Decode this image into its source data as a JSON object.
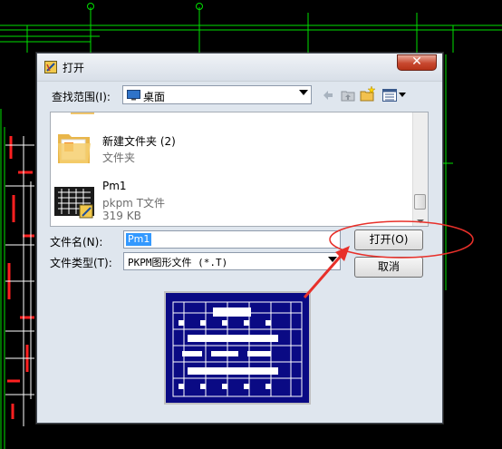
{
  "dialog": {
    "title": "打开",
    "close_glyph": "✕",
    "look_in_label": "查找范围(I):",
    "look_in_value": "桌面",
    "files": [
      {
        "name": "新建文件夹 (2)",
        "type": "文件夹",
        "size": ""
      },
      {
        "name": "Pm1",
        "type": "pkpm T文件",
        "size": "319 KB"
      }
    ],
    "file_name_label": "文件名(N):",
    "file_name_value": "Pm1",
    "file_type_label": "文件类型(T):",
    "file_type_value": "PKPM图形文件 (*.T)",
    "open_button": "打开(O)",
    "cancel_button": "取消"
  },
  "icons": {
    "title": "pkpm-app-icon",
    "back": "back-arrow-icon",
    "up": "up-folder-icon",
    "new_folder": "new-folder-icon",
    "view_menu": "view-menu-icon"
  },
  "colors": {
    "cad_background": "#000000",
    "cad_green": "#00e000",
    "cad_red": "#ff2020",
    "dialog_bg": "#dfe6ee",
    "close_red": "#c8482f",
    "selection_blue": "#3399ff",
    "preview_blue": "#0a0a84",
    "annotation_red": "#e8302a"
  }
}
